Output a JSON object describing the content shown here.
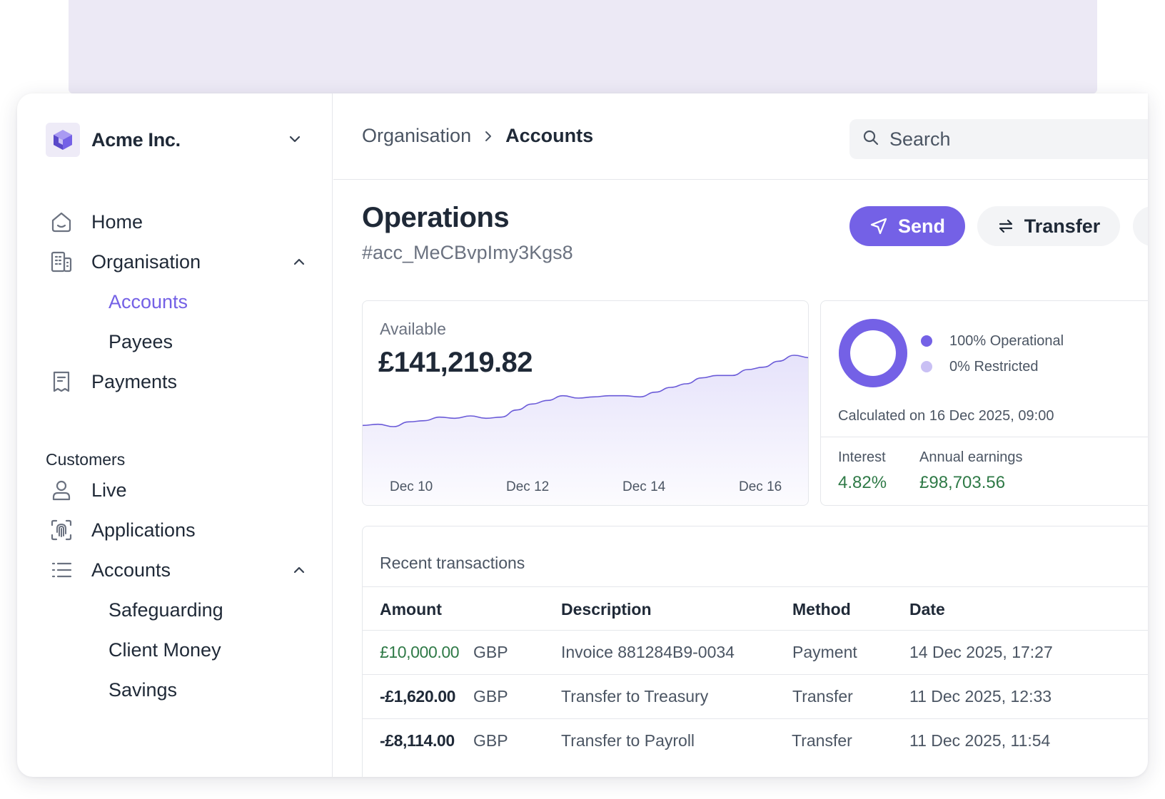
{
  "org": {
    "name": "Acme Inc."
  },
  "nav": {
    "home": "Home",
    "organisation": "Organisation",
    "org_children": [
      "Accounts",
      "Payees"
    ],
    "payments": "Payments",
    "section_customers": "Customers",
    "live": "Live",
    "applications": "Applications",
    "accounts": "Accounts",
    "accounts_children": [
      "Safeguarding",
      "Client Money",
      "Savings"
    ]
  },
  "breadcrumb": {
    "parent": "Organisation",
    "current": "Accounts"
  },
  "search": {
    "placeholder": "Search"
  },
  "account": {
    "title": "Operations",
    "id": "#acc_MeCBvpImy3Kgs8"
  },
  "actions": {
    "send": "Send",
    "transfer": "Transfer"
  },
  "balance": {
    "label": "Available",
    "value": "£141,219.82"
  },
  "chart_data": {
    "type": "area",
    "x_ticks": [
      "Dec 10",
      "Dec 12",
      "Dec 14",
      "Dec 16"
    ],
    "values": [
      100,
      101,
      99,
      103,
      104,
      107,
      106,
      108,
      106,
      107,
      113,
      118,
      121,
      125,
      123,
      124,
      125,
      125,
      124,
      128,
      132,
      135,
      140,
      142,
      142,
      147,
      149,
      154,
      159,
      157
    ],
    "color": "#7461e6"
  },
  "status": {
    "legend": [
      "100% Operational",
      "0% Restricted"
    ],
    "operational_pct": 100,
    "colors": {
      "operational": "#7461e6",
      "restricted": "#c9c0f4"
    },
    "calculated": "Calculated on 16 Dec 2025, 09:00",
    "interest_label": "Interest",
    "interest_value": "4.82%",
    "earnings_label": "Annual earnings",
    "earnings_value": "£98,703.56"
  },
  "transactions": {
    "title": "Recent transactions",
    "columns": [
      "Amount",
      "Description",
      "Method",
      "Date"
    ],
    "rows": [
      {
        "amount": "£10,000.00",
        "currency": "GBP",
        "description": "Invoice 881284B9-0034",
        "method": "Payment",
        "date": "14 Dec 2025, 17:27"
      },
      {
        "amount": "-£1,620.00",
        "currency": "GBP",
        "description": "Transfer to Treasury",
        "method": "Transfer",
        "date": "11 Dec  2025, 12:33"
      },
      {
        "amount": "-£8,114.00",
        "currency": "GBP",
        "description": "Transfer to Payroll",
        "method": "Transfer",
        "date": "11 Dec  2025, 11:54"
      }
    ]
  }
}
